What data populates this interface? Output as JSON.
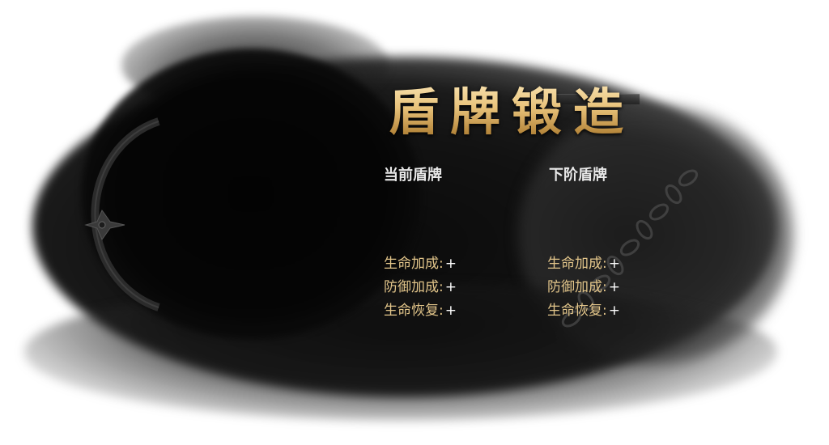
{
  "panel": {
    "title": "盾牌锻造"
  },
  "current": {
    "header": "当前盾牌",
    "stats": [
      {
        "label": "生命加成",
        "sep": ":",
        "value": "+"
      },
      {
        "label": "防御加成",
        "sep": ":",
        "value": "+"
      },
      {
        "label": "生命恢复",
        "sep": ":",
        "value": "+"
      }
    ]
  },
  "next": {
    "header": "下阶盾牌",
    "stats": [
      {
        "label": "生命加成",
        "sep": ":",
        "value": "+"
      },
      {
        "label": "防御加成",
        "sep": ":",
        "value": "+"
      },
      {
        "label": "生命恢复",
        "sep": ":",
        "value": "+"
      }
    ]
  },
  "colors": {
    "title_gold": "#e6c789",
    "label_gold": "#e2c58a",
    "header_white": "#e8e8e8",
    "ink": "#0a0a0a"
  },
  "icons": [
    "ink-splash-background",
    "shield-emblem-icon",
    "chain-decoration"
  ]
}
